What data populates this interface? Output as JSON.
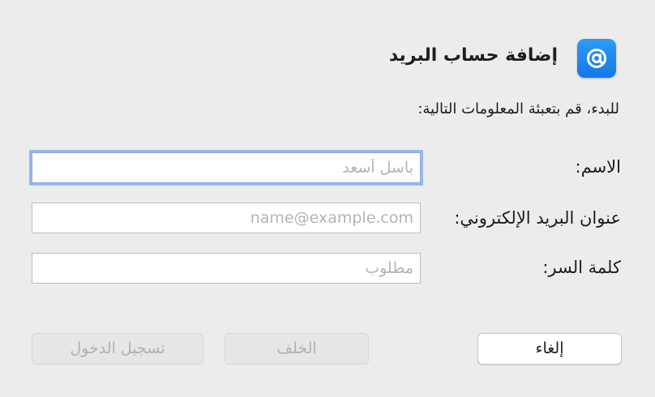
{
  "dialog": {
    "icon": "at-sign-icon",
    "title": "إضافة حساب البريد",
    "subtitle": "للبدء، قم بتعبئة المعلومات التالية:",
    "fields": {
      "name": {
        "label": "الاسم:",
        "placeholder": "باسل أسعد",
        "value": ""
      },
      "email": {
        "label": "عنوان البريد الإلكتروني:",
        "placeholder": "name@example.com",
        "value": ""
      },
      "password": {
        "label": "كلمة السر:",
        "placeholder": "مطلوب",
        "value": ""
      }
    },
    "buttons": {
      "sign_in": "تسجيل الدخول",
      "back": "الخلف",
      "cancel": "إلغاء"
    }
  },
  "colors": {
    "background": "#ececec",
    "icon_gradient_top": "#2f9bf7",
    "icon_gradient_bottom": "#1478e6",
    "focus_ring": "#8aa9e4",
    "disabled_text": "#b2b2b2"
  }
}
